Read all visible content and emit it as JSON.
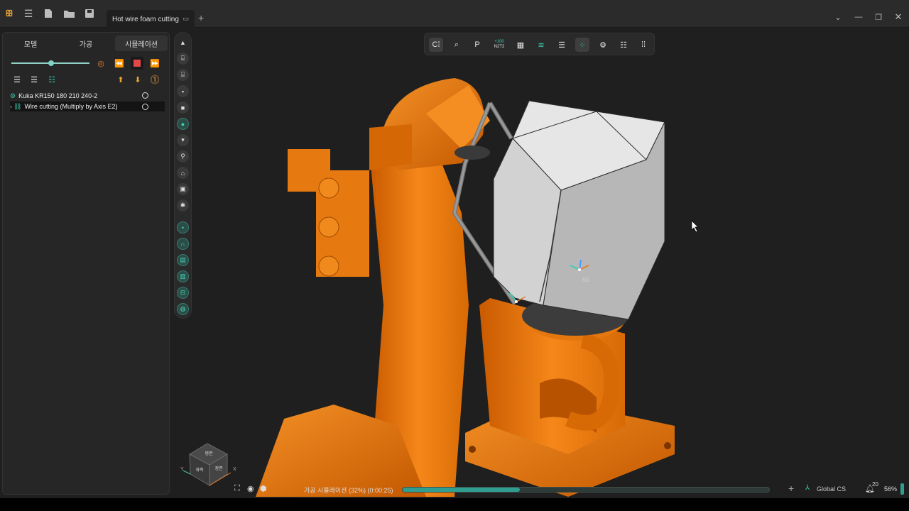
{
  "titlebar": {
    "tab_title": "Hot wire foam cutting",
    "icons": [
      "app-logo-icon",
      "menu-icon",
      "new-file-icon",
      "open-folder-icon",
      "save-icon"
    ]
  },
  "left_panel": {
    "tabs": [
      {
        "label": "모델"
      },
      {
        "label": "가공"
      },
      {
        "label": "시뮬레이션"
      }
    ],
    "tree": [
      {
        "label": "Kuka KR150 180 210 240-2"
      },
      {
        "label": "Wire cutting (Multiply by Axis E2)"
      }
    ]
  },
  "top_toolbar": {
    "nc_label_top": "+100",
    "nc_label_bottom": "N2T2"
  },
  "viewport": {
    "axis_label": "N1",
    "viewcube": {
      "top": "평면",
      "left": "좌측",
      "right": "정면",
      "y": "Y",
      "x": "X"
    }
  },
  "status": {
    "progress_text": "가공 시뮬레이션 (32%) (0:00:25)",
    "progress_fraction": 0.32,
    "cs_label": "Global CS",
    "notif_count": "20",
    "zoom": "56%"
  },
  "colors": {
    "accent": "#2f9d8f",
    "robot": "#f07d12",
    "stop": "#e24848"
  }
}
